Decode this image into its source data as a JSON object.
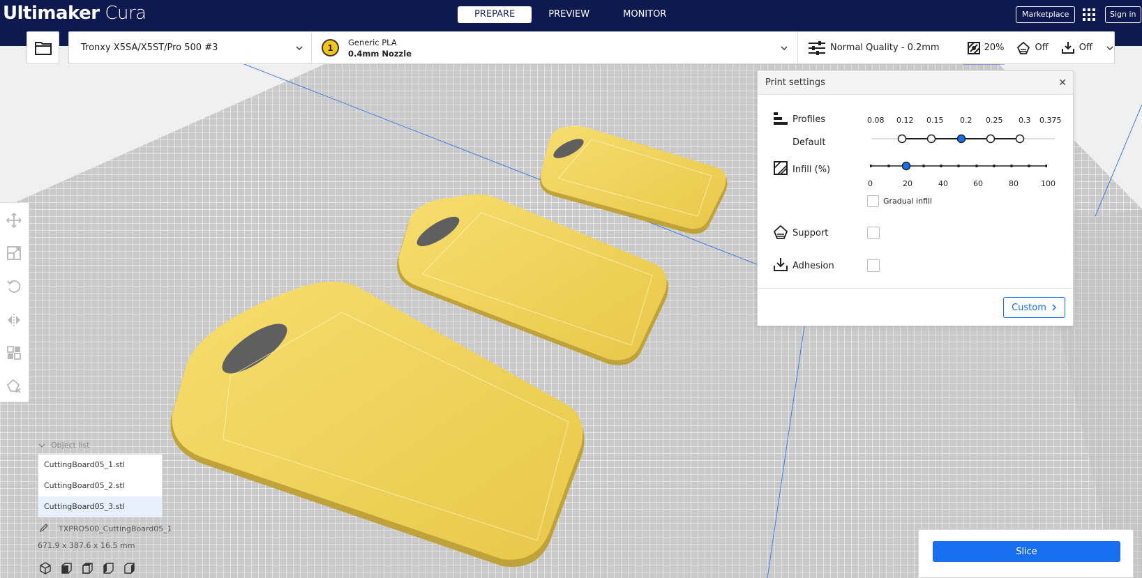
{
  "app": {
    "logo_bold": "Ultimaker",
    "logo_light": "Cura"
  },
  "stages": [
    {
      "label": "PREPARE",
      "active": true
    },
    {
      "label": "PREVIEW",
      "active": false
    },
    {
      "label": "MONITOR",
      "active": false
    }
  ],
  "topbar": {
    "marketplace_label": "Marketplace",
    "signin_label": "Sign in"
  },
  "header": {
    "printer": "Tronxy X5SA/X5ST/Pro 500 #3",
    "extruder_number": "1",
    "material": "Generic PLA",
    "nozzle": "0.4mm Nozzle",
    "quality": "Normal Quality - 0.2mm",
    "infill": "20%",
    "support": "Off",
    "adhesion": "Off"
  },
  "print_settings": {
    "title": "Print settings",
    "profiles_label": "Profiles",
    "profile_name": "Default",
    "layer_heights": [
      "0.08",
      "0.12",
      "0.15",
      "0.2",
      "0.25",
      "0.3",
      "0.375"
    ],
    "selected_layer_height": "0.2",
    "infill_label": "Infill (%)",
    "infill_ticks": [
      "0",
      "20",
      "40",
      "60",
      "80",
      "100"
    ],
    "infill_value": 20,
    "gradual_infill_label": "Gradual infill",
    "gradual_infill_checked": false,
    "support_label": "Support",
    "support_checked": false,
    "adhesion_label": "Adhesion",
    "adhesion_checked": false,
    "custom_label": "Custom"
  },
  "object_list": {
    "header": "Object list",
    "items": [
      {
        "name": "CuttingBoard05_1.stl",
        "selected": false
      },
      {
        "name": "CuttingBoard05_2.stl",
        "selected": false
      },
      {
        "name": "CuttingBoard05_3.stl",
        "selected": true
      }
    ],
    "job_name": "TXPRO500_CuttingBoard05_1",
    "dimensions": "671.9 x 387.6 x 16.5 mm"
  },
  "slice": {
    "label": "Slice"
  },
  "colors": {
    "topbar": "#0e1a4f",
    "accent": "#196ef0",
    "model_yellow": "#f2d45a",
    "build_plate": "#cfcfcf"
  }
}
